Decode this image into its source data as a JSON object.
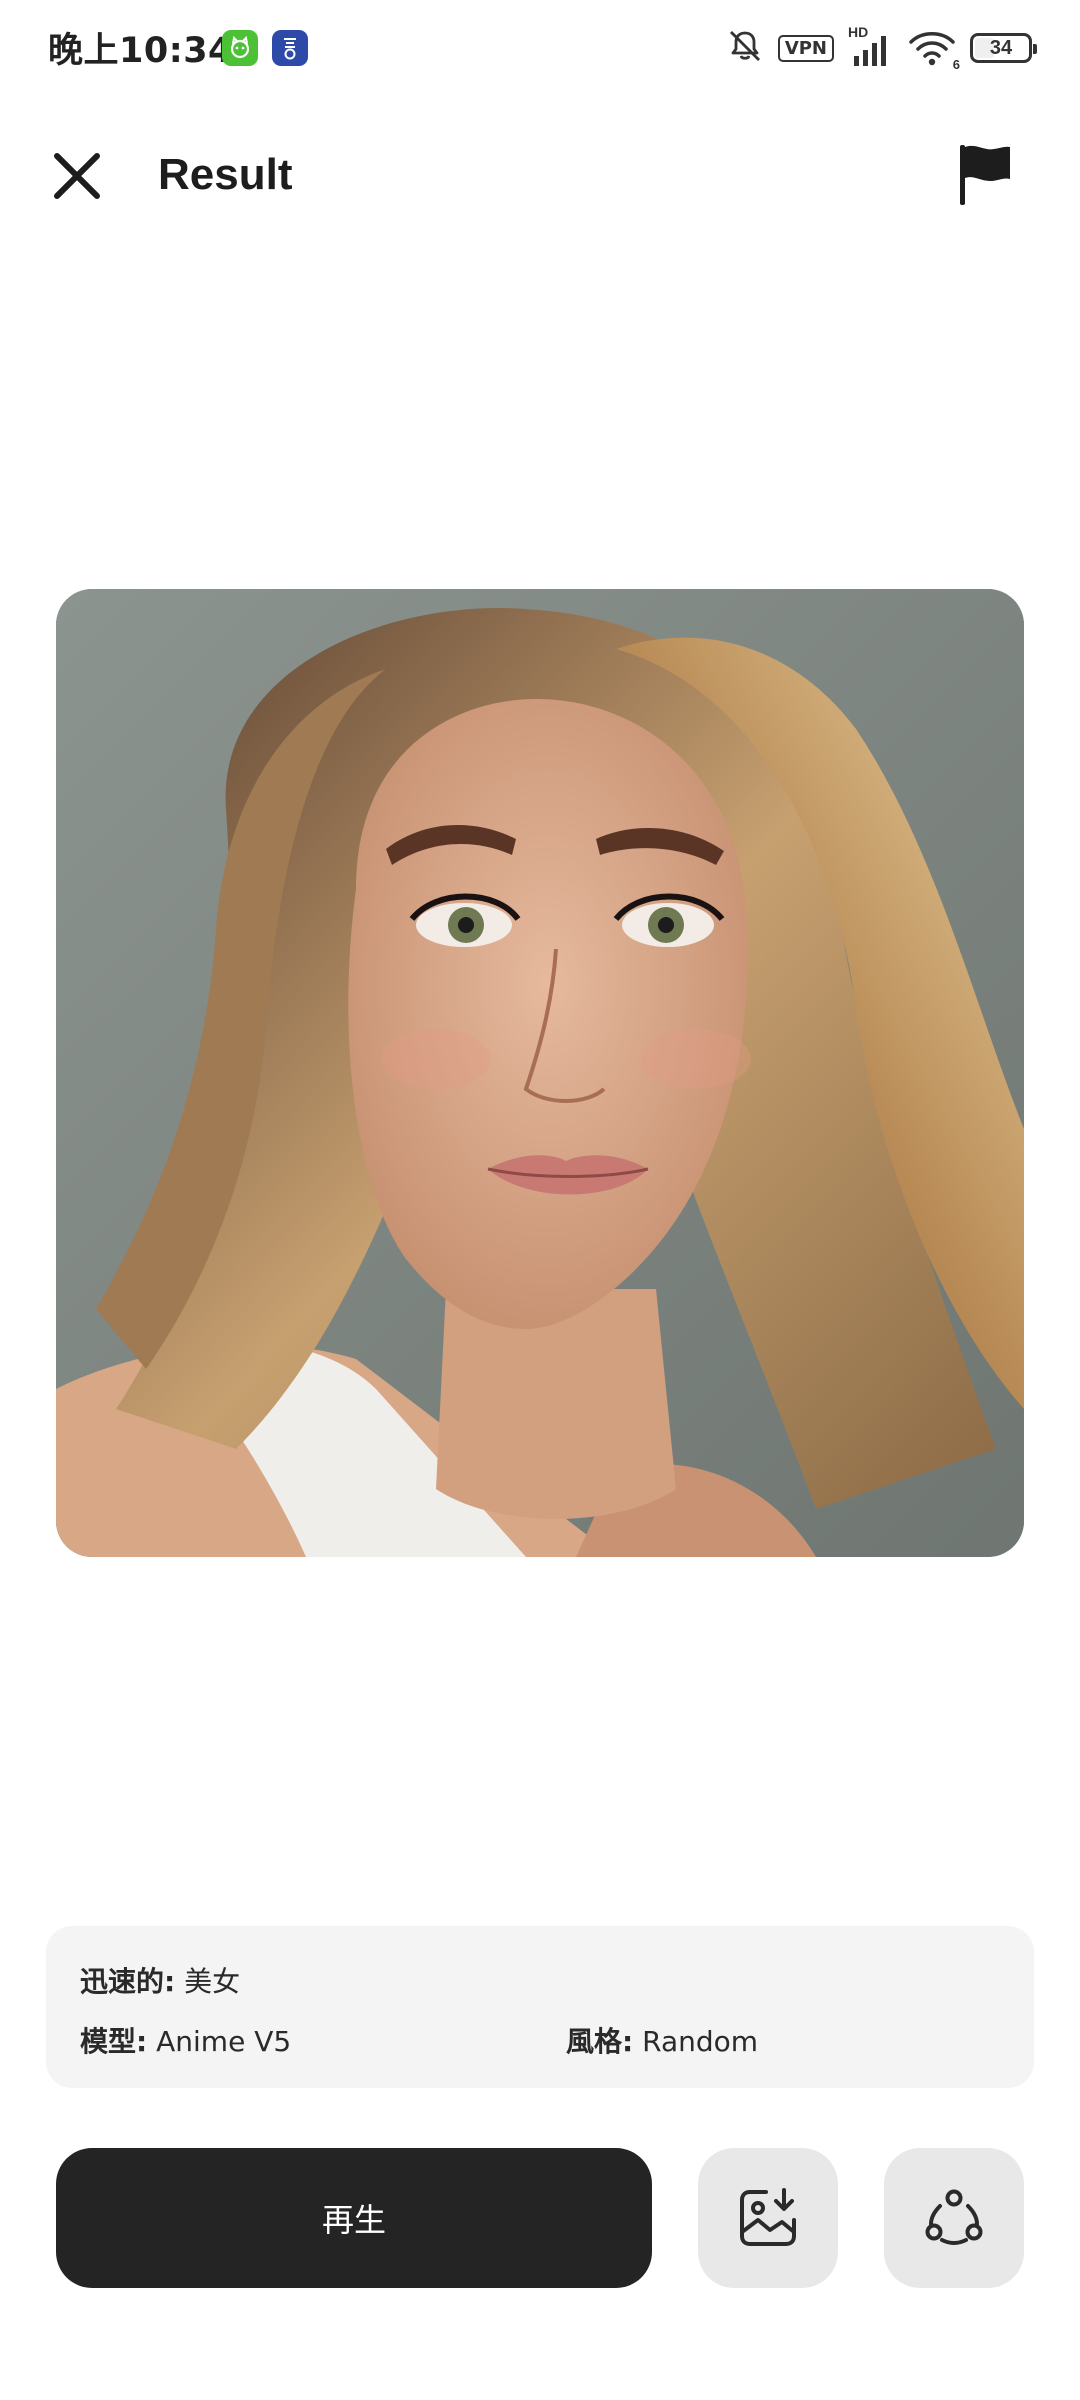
{
  "status_bar": {
    "time": "晚上10:34",
    "app_badge_1_icon": "cat-app-icon",
    "app_badge_2_icon": "notes-app-icon",
    "vpn": "VPN",
    "hd": "HD",
    "wifi_band": "6",
    "battery": "34",
    "battery_level": 0.34
  },
  "header": {
    "title": "Result",
    "close_icon": "close-icon",
    "flag_icon": "flag-icon"
  },
  "result": {
    "image_icon": "generated-portrait-image"
  },
  "info": {
    "prompt_label": "迅速的:",
    "prompt_value": "美女",
    "model_label": "模型:",
    "model_value": "Anime V5",
    "style_label": "風格:",
    "style_value": "Random"
  },
  "actions": {
    "regenerate_label": "再生",
    "save_icon": "save-image-icon",
    "share_icon": "share-icon"
  },
  "colors": {
    "primary_button": "#242424",
    "secondary_button": "#e8e8e8",
    "card_background": "#f4f4f4",
    "app_badge_green": "#4cc136",
    "app_badge_blue": "#2e4aa8"
  }
}
